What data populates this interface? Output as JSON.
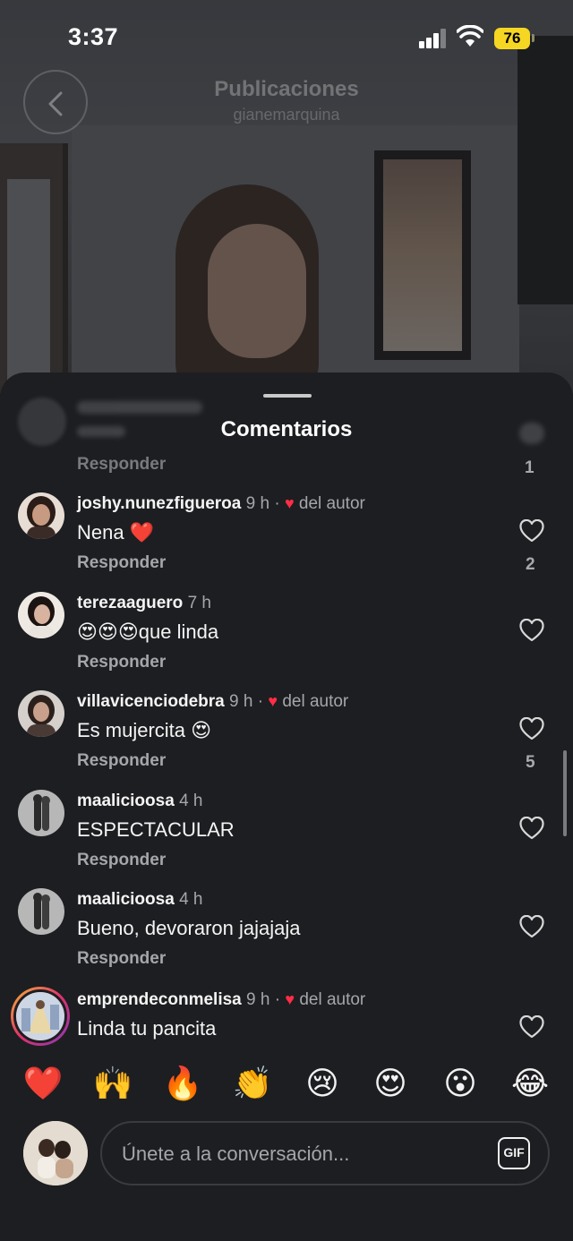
{
  "status_bar": {
    "time": "3:37",
    "battery": "76"
  },
  "header": {
    "title": "Publicaciones",
    "subtitle": "gianemarquina"
  },
  "sheet": {
    "title": "Comentarios",
    "faded_comment": {
      "reply_label": "Responder",
      "like_count": "1"
    }
  },
  "comments": [
    {
      "username": "joshy.nunezfigueroa",
      "time": "9 h",
      "dot": "·",
      "liked_by_author": true,
      "author_label": "del autor",
      "text": "Nena ❤️",
      "reply_label": "Responder",
      "like_count": "2"
    },
    {
      "username": "terezaaguero",
      "time": "7 h",
      "dot": "",
      "liked_by_author": false,
      "author_label": "",
      "text": "😍😍😍que linda",
      "reply_label": "Responder",
      "like_count": ""
    },
    {
      "username": "villavicenciodebra",
      "time": "9 h",
      "dot": "·",
      "liked_by_author": true,
      "author_label": "del autor",
      "text": "Es mujercita 😍",
      "reply_label": "Responder",
      "like_count": "5"
    },
    {
      "username": "maalicioosa",
      "time": "4 h",
      "dot": "",
      "liked_by_author": false,
      "author_label": "",
      "text": "ESPECTACULAR",
      "reply_label": "Responder",
      "like_count": ""
    },
    {
      "username": "maalicioosa",
      "time": "4 h",
      "dot": "",
      "liked_by_author": false,
      "author_label": "",
      "text": "Bueno, devoraron jajajaja",
      "reply_label": "Responder",
      "like_count": ""
    },
    {
      "username": "emprendeconmelisa",
      "time": "9 h",
      "dot": "·",
      "liked_by_author": true,
      "author_label": "del autor",
      "text": "Linda tu pancita",
      "reply_label": "",
      "like_count": ""
    }
  ],
  "emoji_bar": [
    "❤️",
    "🙌",
    "🔥",
    "👏",
    "😢",
    "😍",
    "😮",
    "😂"
  ],
  "composer": {
    "placeholder": "Únete a la conversación...",
    "gif_label": "GIF"
  },
  "icons": {
    "back": "chevron-left-icon",
    "like": "heart-outline-icon",
    "author_like": "heart-filled-icon"
  },
  "colors": {
    "accent_red": "#ff2d45",
    "battery": "#f5d622",
    "sheet_bg": "#1d1e21"
  }
}
